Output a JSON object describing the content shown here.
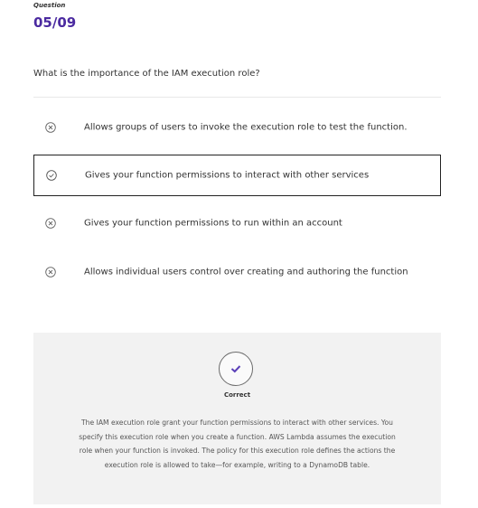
{
  "question": {
    "label": "Question",
    "number": "05/09",
    "text": "What is the importance of the IAM execution role?"
  },
  "options": [
    {
      "text": "Allows groups of users to invoke the execution role to test the function.",
      "icon": "x-circle-icon",
      "selected": false
    },
    {
      "text": "Gives your function permissions to interact with other services",
      "icon": "check-circle-icon",
      "selected": true
    },
    {
      "text": "Gives your function permissions to run within an account",
      "icon": "x-circle-icon",
      "selected": false
    },
    {
      "text": "Allows individual users control over creating and authoring the function",
      "icon": "x-circle-icon",
      "selected": false
    }
  ],
  "feedback": {
    "status": "Correct",
    "icon": "checkmark-icon",
    "explanation": "The IAM execution role grant your function permissions to interact with other services. You specify this execution role when you create a function. AWS Lambda assumes the execution role when your function is invoked. The policy for this execution role defines the actions the execution role is allowed to take—for example, writing to a DynamoDB table."
  },
  "colors": {
    "accent": "#4b2aa0",
    "feedback_bg": "#f2f2f2",
    "check": "#5a3fb8"
  }
}
